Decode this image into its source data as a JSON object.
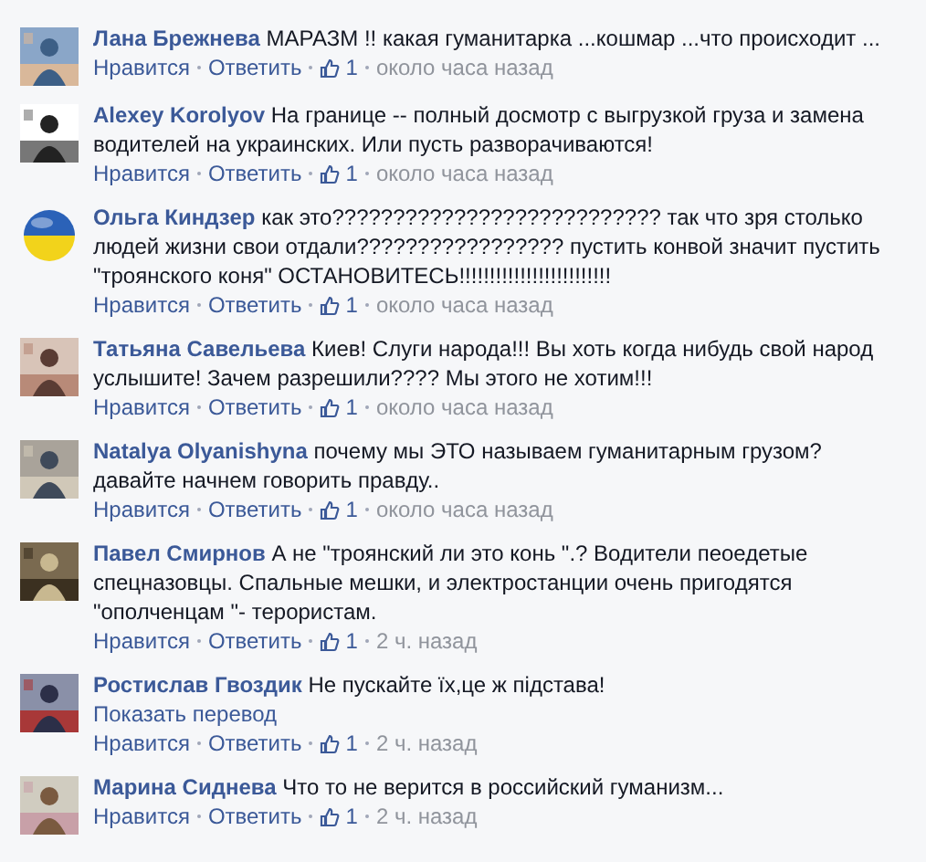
{
  "comments": [
    {
      "author": "Лана Брежнева",
      "text": "МАРАЗМ !! какая гуманитарка ...кошмар ...что происходит ...",
      "actions": {
        "like": "Нравится",
        "reply": "Ответить",
        "likes": "1",
        "time": "около часа назад"
      }
    },
    {
      "author": "Alexey Korolyov",
      "text": "На границе -- полный досмотр с выгрузкой груза и замена водителей на украинских. Или пусть разворачиваются!",
      "actions": {
        "like": "Нравится",
        "reply": "Ответить",
        "likes": "1",
        "time": "около часа назад"
      }
    },
    {
      "author": "Ольга Киндзер",
      "text": "как это??????????????????????????? так что зря столько людей жизни свои отдали????????????????? пустить конвой значит пустить \"троянского коня\" ОСТАНОВИТЕСЬ!!!!!!!!!!!!!!!!!!!!!!!!!",
      "actions": {
        "like": "Нравится",
        "reply": "Ответить",
        "likes": "1",
        "time": "около часа назад"
      }
    },
    {
      "author": "Татьяна Савельева",
      "text": "Киев! Слуги народа!!! Вы хоть когда нибудь свой народ услышите! Зачем разрешили???? Мы этого не хотим!!!",
      "actions": {
        "like": "Нравится",
        "reply": "Ответить",
        "likes": "1",
        "time": "около часа назад"
      }
    },
    {
      "author": "Natalya Olyanishyna",
      "text": "почему мы ЭТО называем гуманитарным грузом? давайте начнем говорить правду..",
      "actions": {
        "like": "Нравится",
        "reply": "Ответить",
        "likes": "1",
        "time": "около часа назад"
      }
    },
    {
      "author": "Павел Смирнов",
      "text": "А не \"троянский ли это конь \".? Водители пеоедетые спецназовцы. Спальные мешки, и электростанции очень пригодятся \"ополченцам \"- терористам.",
      "actions": {
        "like": "Нравится",
        "reply": "Ответить",
        "likes": "1",
        "time": "2 ч. назад"
      }
    },
    {
      "author": "Ростислав Гвоздик",
      "text": "Не пускайте їх,це ж підстава!",
      "translate_link": "Показать перевод",
      "actions": {
        "like": "Нравится",
        "reply": "Ответить",
        "likes": "1",
        "time": "2 ч. назад"
      }
    },
    {
      "author": "Марина Сиднева",
      "text": "Что то не верится в российский гуманизм...",
      "actions": {
        "like": "Нравится",
        "reply": "Ответить",
        "likes": "1",
        "time": "2 ч. назад"
      }
    }
  ]
}
